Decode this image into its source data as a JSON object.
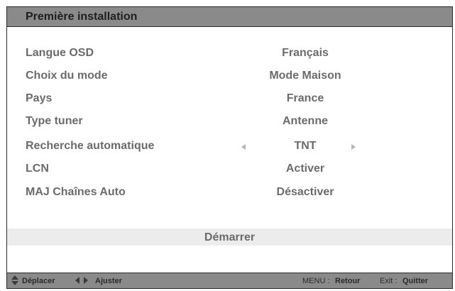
{
  "window": {
    "title": "Première installation"
  },
  "settings": [
    {
      "label": "Langue OSD",
      "value": "Français"
    },
    {
      "label": "Choix du mode",
      "value": "Mode Maison"
    },
    {
      "label": "Pays",
      "value": "France"
    },
    {
      "label": "Type tuner",
      "value": "Antenne"
    },
    {
      "label": "Recherche automatique",
      "value": "TNT"
    },
    {
      "label": "LCN",
      "value": "Activer"
    },
    {
      "label": "MAJ Chaînes Auto",
      "value": "Désactiver"
    }
  ],
  "actions": {
    "start": "Démarrer"
  },
  "footer": {
    "move_label": "Déplacer",
    "adjust_label": "Ajuster",
    "menu_key": "MENU :",
    "menu_action": "Retour",
    "exit_key": "Exit :",
    "exit_action": "Quitter"
  },
  "colors": {
    "titlebar": "#8a8a8a",
    "text": "#6b6b6b",
    "start_bar": "#ececec"
  }
}
